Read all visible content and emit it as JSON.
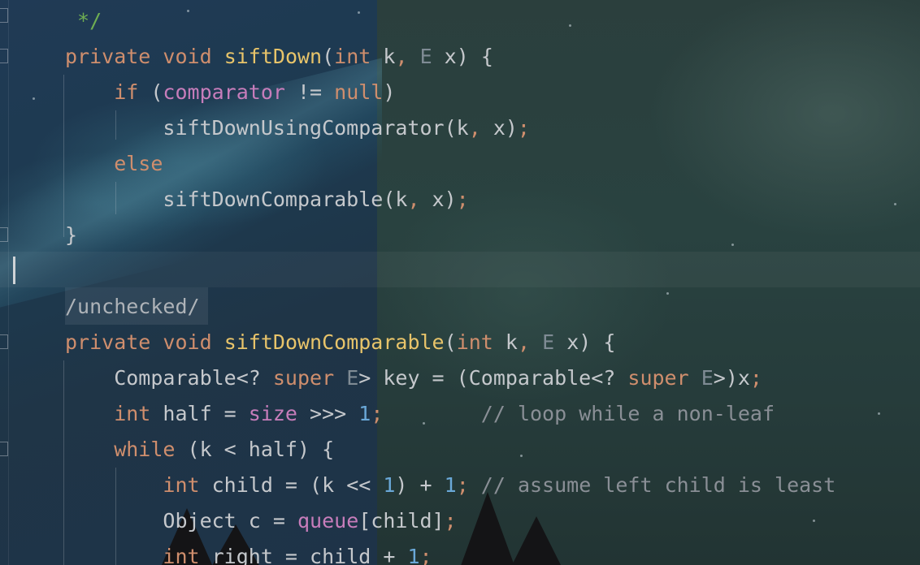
{
  "editor": {
    "lines": [
      {
        "tokens": [
          {
            "t": " */",
            "c": "doc"
          }
        ]
      },
      {
        "tokens": [
          {
            "t": "private ",
            "c": "kw"
          },
          {
            "t": "void ",
            "c": "kw"
          },
          {
            "t": "siftDown",
            "c": "fn"
          },
          {
            "t": "(",
            "c": "type"
          },
          {
            "t": "int ",
            "c": "kw"
          },
          {
            "t": "k",
            "c": "type"
          },
          {
            "t": ", ",
            "c": "punct"
          },
          {
            "t": "E ",
            "c": "tp"
          },
          {
            "t": "x) {",
            "c": "type"
          }
        ]
      },
      {
        "tokens": [
          {
            "t": "    if ",
            "c": "kw"
          },
          {
            "t": "(",
            "c": "type"
          },
          {
            "t": "comparator",
            "c": "field"
          },
          {
            "t": " != ",
            "c": "type"
          },
          {
            "t": "null",
            "c": "kw"
          },
          {
            "t": ")",
            "c": "type"
          }
        ]
      },
      {
        "tokens": [
          {
            "t": "        siftDownUsingComparator(k",
            "c": "type"
          },
          {
            "t": ", ",
            "c": "punct"
          },
          {
            "t": "x)",
            "c": "type"
          },
          {
            "t": ";",
            "c": "punct"
          }
        ]
      },
      {
        "tokens": [
          {
            "t": "    else",
            "c": "kw"
          }
        ]
      },
      {
        "tokens": [
          {
            "t": "        siftDownComparable(k",
            "c": "type"
          },
          {
            "t": ", ",
            "c": "punct"
          },
          {
            "t": "x)",
            "c": "type"
          },
          {
            "t": ";",
            "c": "punct"
          }
        ]
      },
      {
        "tokens": [
          {
            "t": "}",
            "c": "type"
          }
        ]
      },
      {
        "tokens": []
      },
      {
        "tokens": [
          {
            "t": "/unchecked/",
            "c": "annot"
          }
        ]
      },
      {
        "tokens": [
          {
            "t": "private ",
            "c": "kw"
          },
          {
            "t": "void ",
            "c": "kw"
          },
          {
            "t": "siftDownComparable",
            "c": "fn"
          },
          {
            "t": "(",
            "c": "type"
          },
          {
            "t": "int ",
            "c": "kw"
          },
          {
            "t": "k",
            "c": "type"
          },
          {
            "t": ", ",
            "c": "punct"
          },
          {
            "t": "E ",
            "c": "tp"
          },
          {
            "t": "x) {",
            "c": "type"
          }
        ]
      },
      {
        "tokens": [
          {
            "t": "    Comparable<? ",
            "c": "type"
          },
          {
            "t": "super ",
            "c": "kw"
          },
          {
            "t": "E",
            "c": "tp"
          },
          {
            "t": "> key = (Comparable<? ",
            "c": "type"
          },
          {
            "t": "super ",
            "c": "kw"
          },
          {
            "t": "E",
            "c": "tp"
          },
          {
            "t": ">)x",
            "c": "type"
          },
          {
            "t": ";",
            "c": "punct"
          }
        ]
      },
      {
        "tokens": [
          {
            "t": "    int ",
            "c": "kw"
          },
          {
            "t": "half = ",
            "c": "type"
          },
          {
            "t": "size",
            "c": "field"
          },
          {
            "t": " >>> ",
            "c": "type"
          },
          {
            "t": "1",
            "c": "num"
          },
          {
            "t": ";",
            "c": "punct"
          },
          {
            "t": "        // loop while a non-leaf",
            "c": "cmt"
          }
        ]
      },
      {
        "tokens": [
          {
            "t": "    while ",
            "c": "kw"
          },
          {
            "t": "(k < half) {",
            "c": "type"
          }
        ]
      },
      {
        "tokens": [
          {
            "t": "        int ",
            "c": "kw"
          },
          {
            "t": "child = (k << ",
            "c": "type"
          },
          {
            "t": "1",
            "c": "num"
          },
          {
            "t": ") + ",
            "c": "type"
          },
          {
            "t": "1",
            "c": "num"
          },
          {
            "t": "; ",
            "c": "punct"
          },
          {
            "t": "// assume left child is least",
            "c": "cmt"
          }
        ]
      },
      {
        "tokens": [
          {
            "t": "        Object c = ",
            "c": "type"
          },
          {
            "t": "queue",
            "c": "field"
          },
          {
            "t": "[child]",
            "c": "type"
          },
          {
            "t": ";",
            "c": "punct"
          }
        ]
      },
      {
        "tokens": [
          {
            "t": "        int ",
            "c": "kw"
          },
          {
            "t": "right = child + ",
            "c": "type"
          },
          {
            "t": "1",
            "c": "num"
          },
          {
            "t": ";",
            "c": "punct"
          }
        ]
      }
    ]
  }
}
